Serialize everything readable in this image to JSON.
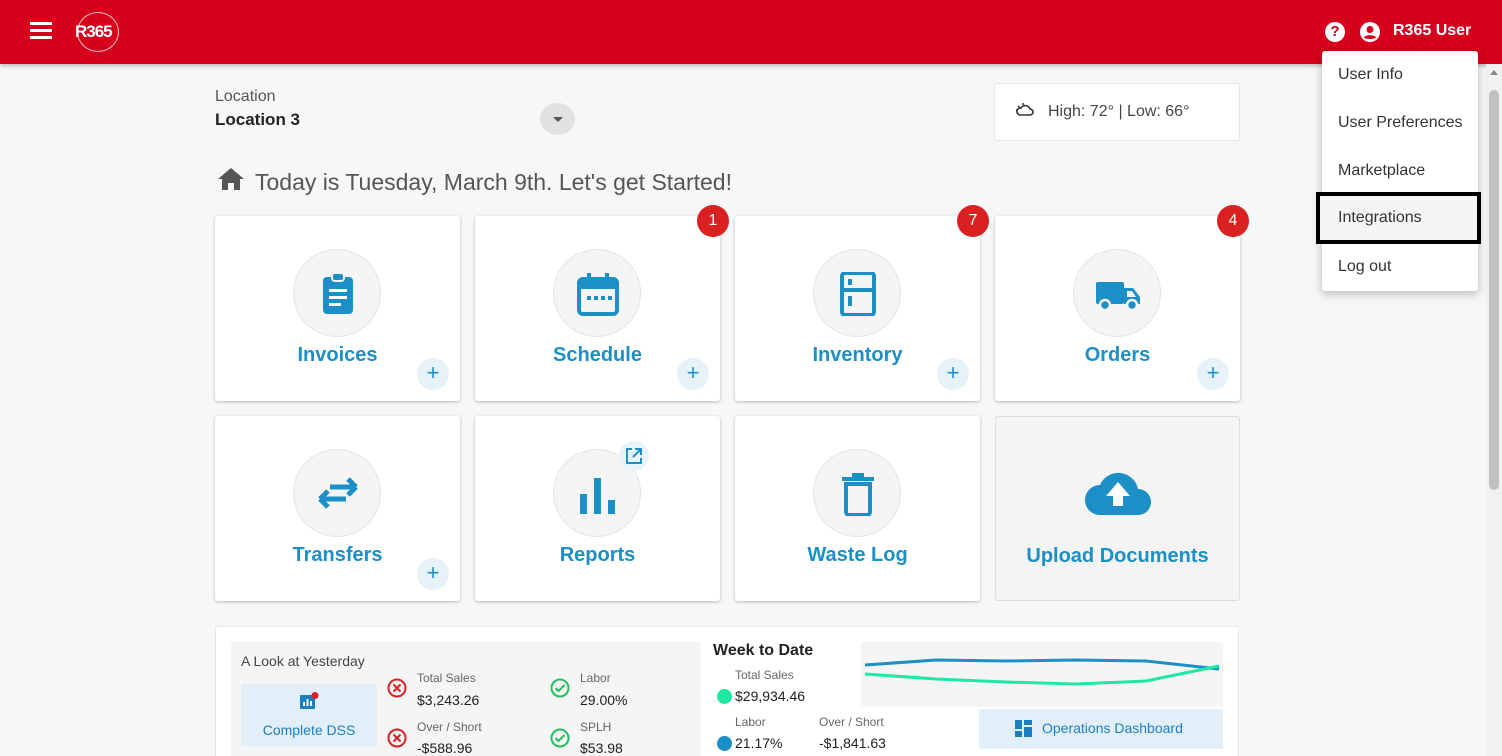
{
  "header": {
    "logo_text": "R365",
    "help_icon": "help-circle-icon",
    "user_icon": "account-circle-icon",
    "user_name": "R365 User"
  },
  "location": {
    "label": "Location",
    "value": "Location 3"
  },
  "weather": {
    "icon": "cloud-sun-icon",
    "text": "High: 72° | Low: 66°"
  },
  "greeting": "Today is Tuesday, March 9th. Let's get Started!",
  "tiles": [
    {
      "label": "Invoices",
      "icon": "clipboard-icon",
      "badge": null,
      "has_add": true
    },
    {
      "label": "Schedule",
      "icon": "calendar-icon",
      "badge": "1",
      "has_add": true
    },
    {
      "label": "Inventory",
      "icon": "fridge-icon",
      "badge": "7",
      "has_add": true
    },
    {
      "label": "Orders",
      "icon": "truck-icon",
      "badge": "4",
      "has_add": true
    },
    {
      "label": "Transfers",
      "icon": "swap-arrows-icon",
      "badge": null,
      "has_add": true
    },
    {
      "label": "Reports",
      "icon": "bar-chart-icon",
      "badge": null,
      "has_add": false,
      "external": true
    },
    {
      "label": "Waste Log",
      "icon": "trash-icon",
      "badge": null,
      "has_add": false
    },
    {
      "label": "Upload Documents",
      "icon": "cloud-upload-icon",
      "badge": null,
      "has_add": false
    }
  ],
  "user_menu": {
    "items": [
      {
        "label": "User Info"
      },
      {
        "label": "User Preferences"
      },
      {
        "label": "Marketplace"
      },
      {
        "label": "Integrations",
        "highlighted": true
      },
      {
        "label": "Log out"
      }
    ]
  },
  "yesterday": {
    "title": "A Look at Yesterday",
    "button_label": "Complete DSS",
    "metrics": [
      {
        "label": "Total Sales",
        "value": "$3,243.26",
        "status": "bad"
      },
      {
        "label": "Over / Short",
        "value": "-$588.96",
        "status": "bad"
      },
      {
        "label": "Labor",
        "value": "29.00%",
        "status": "good"
      },
      {
        "label": "SPLH",
        "value": "$53.98",
        "status": "good"
      }
    ]
  },
  "week_to_date": {
    "title": "Week to Date",
    "total_sales_label": "Total Sales",
    "total_sales_value": "$29,934.46",
    "labor_label": "Labor",
    "labor_value": "21.17%",
    "over_short_label": "Over / Short",
    "over_short_value": "-$1,841.63",
    "colors": {
      "sales": "#1de9a0",
      "labor": "#1b8fc6"
    },
    "button_label": "Operations Dashboard"
  },
  "colors": {
    "brand_red": "#d6001c",
    "accent_blue": "#1b8fc6",
    "badge_red": "#d92121"
  }
}
